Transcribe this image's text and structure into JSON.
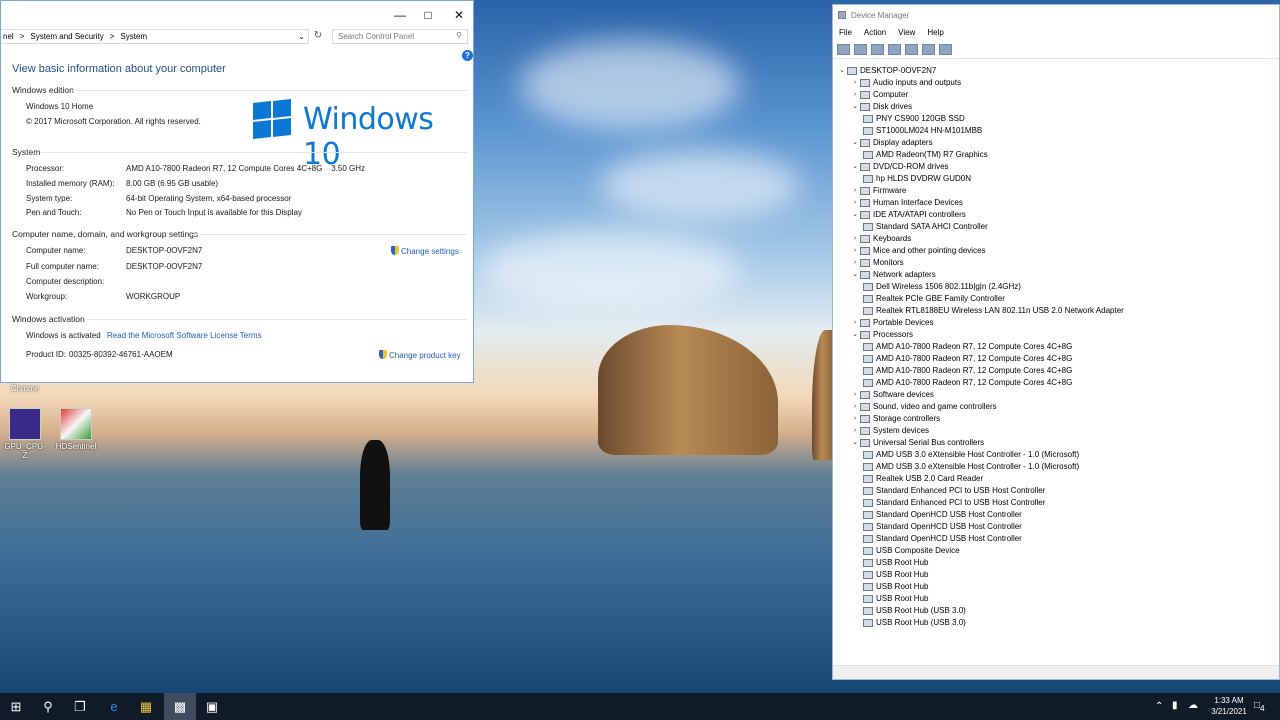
{
  "control_panel": {
    "breadcrumb": [
      "nel",
      "System and Security",
      "System"
    ],
    "search_placeholder": "Search Control Panel",
    "heading": "View basic information about your computer",
    "windows_edition": {
      "section": "Windows edition",
      "edition": "Windows 10 Home",
      "copyright": "© 2017 Microsoft Corporation. All rights reserved.",
      "logo_text": "Windows 10"
    },
    "system": {
      "section": "System",
      "rows": [
        {
          "label": "Processor:",
          "value": "AMD A10-7800 Radeon R7, 12 Compute Cores 4C+8G    3.50 GHz"
        },
        {
          "label": "Installed memory (RAM):",
          "value": "8.00 GB (6.95 GB usable)"
        },
        {
          "label": "System type:",
          "value": "64-bit Operating System, x64-based processor"
        },
        {
          "label": "Pen and Touch:",
          "value": "No Pen or Touch Input is available for this Display"
        }
      ]
    },
    "computer_name": {
      "section": "Computer name, domain, and workgroup settings",
      "change_link": "Change settings",
      "rows": [
        {
          "label": "Computer name:",
          "value": "DESKTOP-0OVF2N7"
        },
        {
          "label": "Full computer name:",
          "value": "DESKTOP-0OVF2N7"
        },
        {
          "label": "Computer description:",
          "value": ""
        },
        {
          "label": "Workgroup:",
          "value": "WORKGROUP"
        }
      ]
    },
    "activation": {
      "section": "Windows activation",
      "status": "Windows is activated",
      "license_link": "Read the Microsoft Software License Terms",
      "product_id_label": "Product ID:",
      "product_id": "00325-80392-46761-AAOEM",
      "change_key_link": "Change product key"
    }
  },
  "desktop_icons": [
    {
      "label": "Chrome",
      "icon": "chrome-icon"
    },
    {
      "label": "GPU_CPU-Z",
      "icon": "cpuz-icon"
    },
    {
      "label": "HDSentinel",
      "icon": "hdsentinel-icon"
    }
  ],
  "device_manager": {
    "title": "Device Manager",
    "menu": [
      "File",
      "Action",
      "View",
      "Help"
    ],
    "tree": [
      {
        "text": "DESKTOP-0OVF2N7",
        "level": 0,
        "exp": "v"
      },
      {
        "text": "Audio inputs and outputs",
        "level": 1,
        "exp": ">"
      },
      {
        "text": "Computer",
        "level": 1,
        "exp": ">"
      },
      {
        "text": "Disk drives",
        "level": 1,
        "exp": "v"
      },
      {
        "text": "PNY CS900 120GB SSD",
        "level": 2,
        "exp": ""
      },
      {
        "text": "ST1000LM024 HN-M101MBB",
        "level": 2,
        "exp": ""
      },
      {
        "text": "Display adapters",
        "level": 1,
        "exp": "v"
      },
      {
        "text": "AMD Radeon(TM) R7 Graphics",
        "level": 2,
        "exp": ""
      },
      {
        "text": "DVD/CD-ROM drives",
        "level": 1,
        "exp": "v"
      },
      {
        "text": "hp HLDS DVDRW  GUD0N",
        "level": 2,
        "exp": ""
      },
      {
        "text": "Firmware",
        "level": 1,
        "exp": ">"
      },
      {
        "text": "Human Interface Devices",
        "level": 1,
        "exp": ">"
      },
      {
        "text": "IDE ATA/ATAPI controllers",
        "level": 1,
        "exp": "v"
      },
      {
        "text": "Standard SATA AHCI Controller",
        "level": 2,
        "exp": ""
      },
      {
        "text": "Keyboards",
        "level": 1,
        "exp": ">"
      },
      {
        "text": "Mice and other pointing devices",
        "level": 1,
        "exp": ">"
      },
      {
        "text": "Monitors",
        "level": 1,
        "exp": ">"
      },
      {
        "text": "Network adapters",
        "level": 1,
        "exp": "v"
      },
      {
        "text": "Dell Wireless 1506 802.11b|g|n (2.4GHz)",
        "level": 2,
        "exp": ""
      },
      {
        "text": "Realtek PCIe GBE Family Controller",
        "level": 2,
        "exp": ""
      },
      {
        "text": "Realtek RTL8188EU Wireless LAN 802.11n USB 2.0 Network Adapter",
        "level": 2,
        "exp": ""
      },
      {
        "text": "Portable Devices",
        "level": 1,
        "exp": ">"
      },
      {
        "text": "Processors",
        "level": 1,
        "exp": "v"
      },
      {
        "text": "AMD A10-7800 Radeon R7, 12 Compute Cores 4C+8G",
        "level": 2,
        "exp": ""
      },
      {
        "text": "AMD A10-7800 Radeon R7, 12 Compute Cores 4C+8G",
        "level": 2,
        "exp": ""
      },
      {
        "text": "AMD A10-7800 Radeon R7, 12 Compute Cores 4C+8G",
        "level": 2,
        "exp": ""
      },
      {
        "text": "AMD A10-7800 Radeon R7, 12 Compute Cores 4C+8G",
        "level": 2,
        "exp": ""
      },
      {
        "text": "Software devices",
        "level": 1,
        "exp": ">"
      },
      {
        "text": "Sound, video and game controllers",
        "level": 1,
        "exp": ">"
      },
      {
        "text": "Storage controllers",
        "level": 1,
        "exp": ">"
      },
      {
        "text": "System devices",
        "level": 1,
        "exp": ">"
      },
      {
        "text": "Universal Serial Bus controllers",
        "level": 1,
        "exp": "v"
      },
      {
        "text": "AMD USB 3.0 eXtensible Host Controller - 1.0 (Microsoft)",
        "level": 2,
        "exp": ""
      },
      {
        "text": "AMD USB 3.0 eXtensible Host Controller - 1.0 (Microsoft)",
        "level": 2,
        "exp": ""
      },
      {
        "text": "Realtek USB 2.0 Card Reader",
        "level": 2,
        "exp": ""
      },
      {
        "text": "Standard Enhanced PCI to USB Host Controller",
        "level": 2,
        "exp": ""
      },
      {
        "text": "Standard Enhanced PCI to USB Host Controller",
        "level": 2,
        "exp": ""
      },
      {
        "text": "Standard OpenHCD USB Host Controller",
        "level": 2,
        "exp": ""
      },
      {
        "text": "Standard OpenHCD USB Host Controller",
        "level": 2,
        "exp": ""
      },
      {
        "text": "Standard OpenHCD USB Host Controller",
        "level": 2,
        "exp": ""
      },
      {
        "text": "USB Composite Device",
        "level": 2,
        "exp": ""
      },
      {
        "text": "USB Root Hub",
        "level": 2,
        "exp": ""
      },
      {
        "text": "USB Root Hub",
        "level": 2,
        "exp": ""
      },
      {
        "text": "USB Root Hub",
        "level": 2,
        "exp": ""
      },
      {
        "text": "USB Root Hub",
        "level": 2,
        "exp": ""
      },
      {
        "text": "USB Root Hub (USB 3.0)",
        "level": 2,
        "exp": ""
      },
      {
        "text": "USB Root Hub (USB 3.0)",
        "level": 2,
        "exp": ""
      }
    ]
  },
  "taskbar": {
    "time": "1:33 AM",
    "date": "3/21/2021",
    "notification_count": "4"
  }
}
